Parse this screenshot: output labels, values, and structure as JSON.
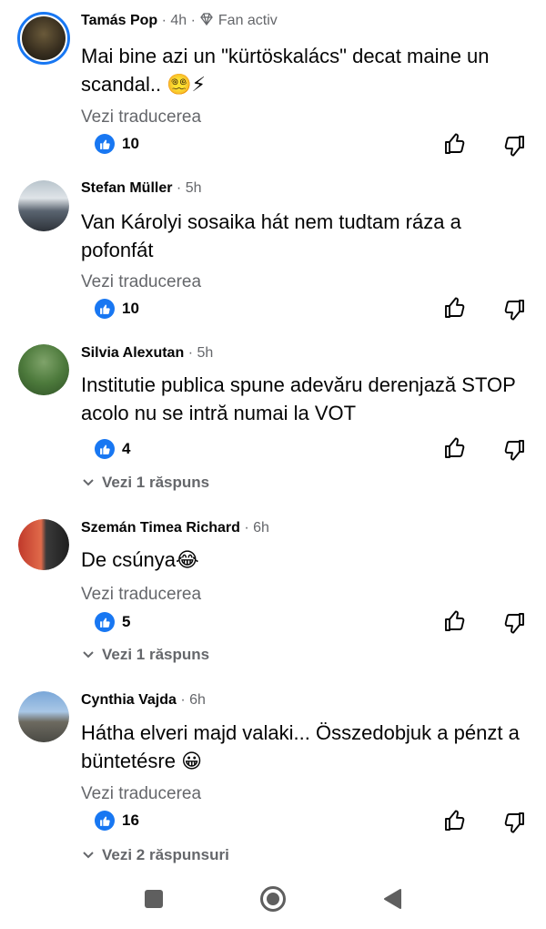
{
  "comments": [
    {
      "name": "Tamás Pop",
      "time": "4h",
      "badge": "Fan activ",
      "text": "Mai bine azi un \"kürtöskalács\" decat maine un scandal.. 😵‍💫⚡",
      "translate": "Vezi traducerea",
      "likes": "10"
    },
    {
      "name": "Stefan Müller",
      "time": "5h",
      "text": "Van Károlyi sosaika hát nem tudtam ráza a pofonfát",
      "translate": "Vezi traducerea",
      "likes": "10"
    },
    {
      "name": "Silvia Alexutan",
      "time": "5h",
      "text": "Institutie publica spune adevăru derenjază STOP acolo nu se intră numai la VOT",
      "likes": "4",
      "replies": "Vezi 1 răspuns"
    },
    {
      "name": "Szemán Timea Richard",
      "time": "6h",
      "text": "De csúnya😂",
      "translate": "Vezi traducerea",
      "likes": "5",
      "replies": "Vezi 1 răspuns"
    },
    {
      "name": "Cynthia Vajda",
      "time": "6h",
      "text": "Hátha elveri majd valaki... Összedobjuk a pénzt a büntetésre 😀",
      "translate": "Vezi traducerea",
      "likes": "16",
      "replies": "Vezi 2 răspunsuri"
    }
  ],
  "colors": {
    "accent": "#1877f2",
    "secondary_text": "#65676b"
  },
  "icons": {
    "like_badge": "thumbs-up-badge-icon",
    "like": "thumbs-up-outline-icon",
    "dislike": "thumbs-down-outline-icon",
    "expand": "chevron-down-icon",
    "fan_badge": "diamond-icon",
    "nav_recents": "square-icon",
    "nav_home": "circle-icon",
    "nav_back": "triangle-back-icon"
  }
}
